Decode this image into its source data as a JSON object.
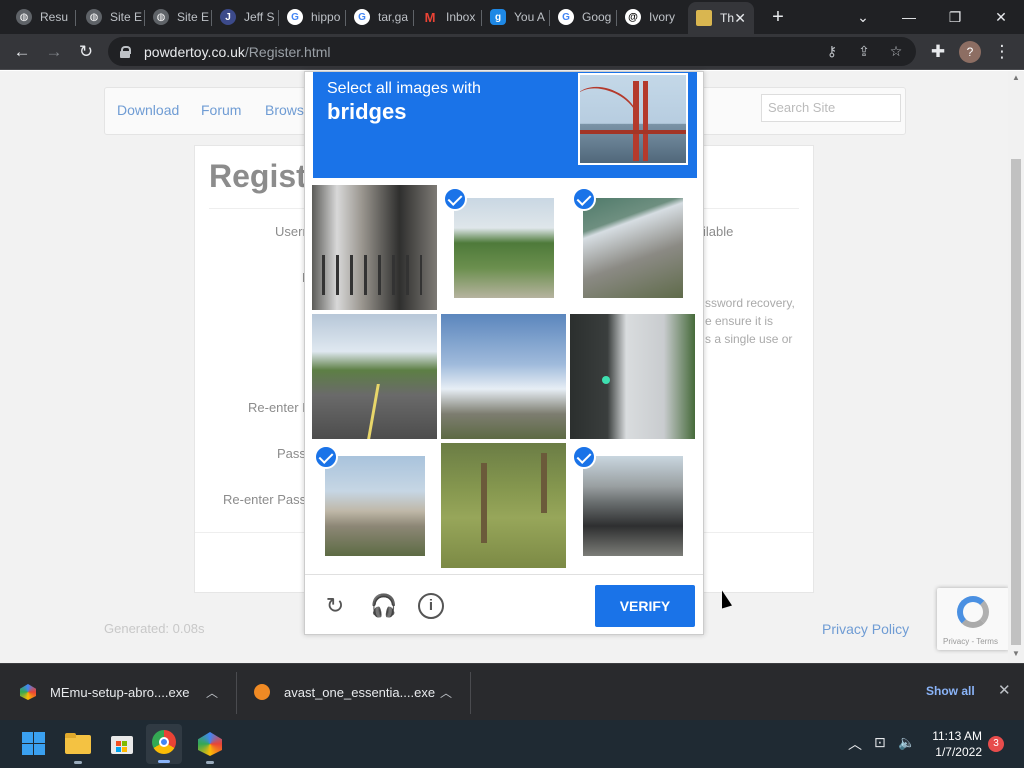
{
  "browser": {
    "tabs": [
      {
        "label": "Resu",
        "favicon": "globe-icon"
      },
      {
        "label": "Site E",
        "favicon": "globe-icon"
      },
      {
        "label": "Site E",
        "favicon": "globe-icon"
      },
      {
        "label": "Jeff S",
        "favicon": "J"
      },
      {
        "label": "hippo",
        "favicon": "google-icon"
      },
      {
        "label": "tar,ga",
        "favicon": "google-icon"
      },
      {
        "label": "Inbox",
        "favicon": "gmail-icon"
      },
      {
        "label": "You A",
        "favicon": "g"
      },
      {
        "label": "Goog",
        "favicon": "google-icon"
      },
      {
        "label": "Ivory",
        "favicon": "threads-icon"
      },
      {
        "label": "Th",
        "favicon": "tab-icon"
      }
    ],
    "url_host": "powdertoy.co.uk",
    "url_path": "/Register.html"
  },
  "site": {
    "nav": [
      "Download",
      "Forum",
      "Browse"
    ],
    "search_placeholder": "Search Site",
    "register_title": "Registe",
    "labels": [
      "Usern",
      "D",
      "Re-enter E",
      "Pass",
      "Re-enter Pass"
    ],
    "help_available": "ilable",
    "help_lines": [
      "ssword recovery,",
      "e ensure it is",
      "s a single use or"
    ],
    "generated": "Generated: 0.08s",
    "privacy": "Privacy Policy",
    "recaptcha_badge": "Privacy - Terms"
  },
  "captcha": {
    "instruction": "Select all images with",
    "target": "bridges",
    "tiles": [
      {
        "selected": false,
        "scene": "street-bikes"
      },
      {
        "selected": true,
        "scene": "park-trees"
      },
      {
        "selected": true,
        "scene": "bridge-underside"
      },
      {
        "selected": false,
        "scene": "road-trees"
      },
      {
        "selected": false,
        "scene": "sky-buildings"
      },
      {
        "selected": false,
        "scene": "traffic-light"
      },
      {
        "selected": true,
        "scene": "overpass"
      },
      {
        "selected": false,
        "scene": "palm-trees"
      },
      {
        "selected": true,
        "scene": "bridge-car"
      }
    ],
    "verify_label": "VERIFY"
  },
  "downloads": {
    "items": [
      "MEmu-setup-abro....exe",
      "avast_one_essentia....exe"
    ],
    "show_all": "Show all"
  },
  "taskbar": {
    "time": "11:13 AM",
    "date": "1/7/2022",
    "notifications": "3"
  },
  "colors": {
    "accent": "#1a73e8",
    "chrome_dark": "#202124",
    "link": "#6f9cd4"
  }
}
